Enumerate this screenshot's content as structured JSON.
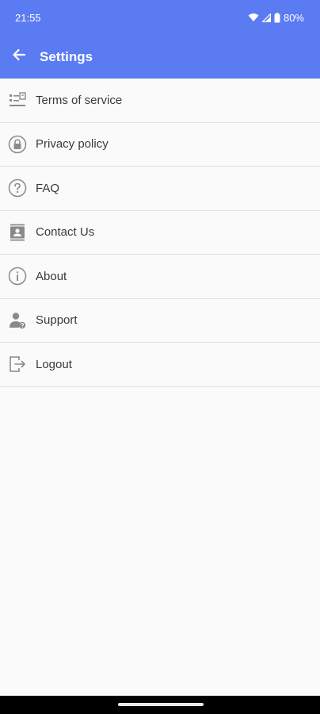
{
  "status_bar": {
    "time": "21:55",
    "battery": "80%",
    "icons": [
      "wifi-icon",
      "signal-icon",
      "battery-icon"
    ]
  },
  "toolbar": {
    "title": "Settings",
    "back_icon": "arrow-left-icon"
  },
  "menu": {
    "items": [
      {
        "label": "Terms of service",
        "icon": "document-list-icon"
      },
      {
        "label": "Privacy policy",
        "icon": "lock-icon"
      },
      {
        "label": "FAQ",
        "icon": "question-icon"
      },
      {
        "label": "Contact Us",
        "icon": "contact-card-icon"
      },
      {
        "label": "About",
        "icon": "info-icon"
      },
      {
        "label": "Support",
        "icon": "support-person-icon"
      },
      {
        "label": "Logout",
        "icon": "logout-icon"
      }
    ]
  },
  "colors": {
    "header": "#5a7bf2",
    "background": "#fafafa",
    "divider": "#e2e2e2",
    "text": "#3a3a3a",
    "icon": "#8a8a8a"
  }
}
